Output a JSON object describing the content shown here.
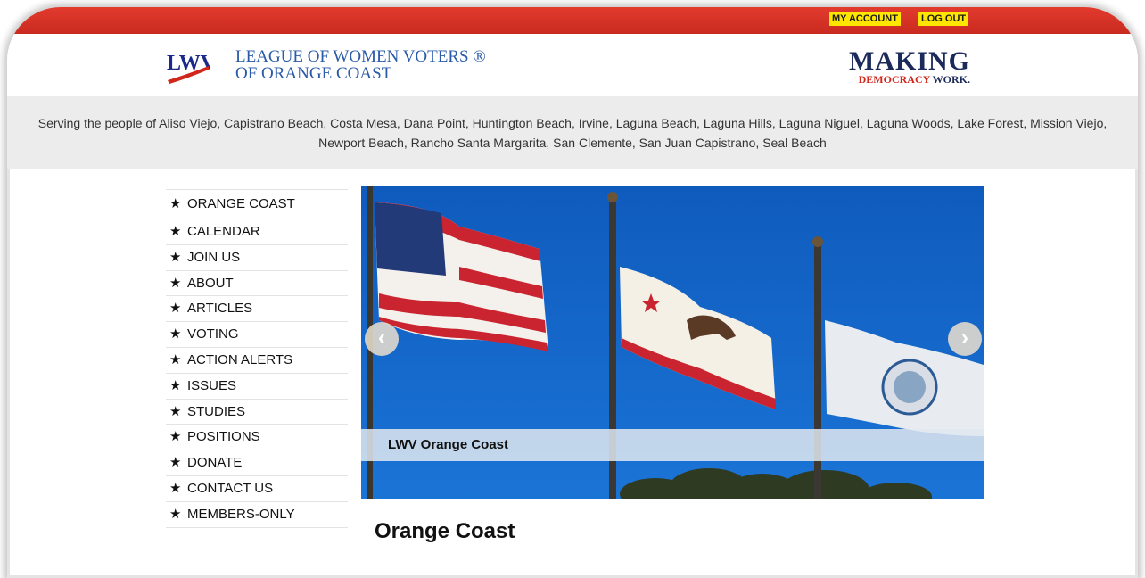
{
  "utility": {
    "my_account": "MY ACCOUNT",
    "log_out": "LOG OUT"
  },
  "header": {
    "logo_text": "LWV",
    "org_line1": "LEAGUE OF WOMEN VOTERS ®",
    "org_line2": "OF ORANGE COAST",
    "tagline_top": "MAKING",
    "tagline_demo": "DEMOCRACY",
    "tagline_work": "WORK."
  },
  "serving": {
    "text": "Serving the people of Aliso Viejo, Capistrano Beach, Costa Mesa, Dana Point, Huntington Beach, Irvine, Laguna Beach, Laguna Hills, Laguna Niguel, Laguna Woods, Lake Forest, Mission Viejo, Newport Beach, Rancho Santa Margarita, San Clemente, San Juan Capistrano, Seal Beach"
  },
  "nav": {
    "items": [
      {
        "label": "ORANGE COAST"
      },
      {
        "label": "CALENDAR"
      },
      {
        "label": "JOIN US"
      },
      {
        "label": "ABOUT"
      },
      {
        "label": "ARTICLES"
      },
      {
        "label": "VOTING"
      },
      {
        "label": "ACTION ALERTS"
      },
      {
        "label": "ISSUES"
      },
      {
        "label": "STUDIES"
      },
      {
        "label": "POSITIONS"
      },
      {
        "label": "DONATE"
      },
      {
        "label": "CONTACT US"
      },
      {
        "label": "MEMBERS-ONLY"
      }
    ]
  },
  "slider": {
    "caption": "LWV Orange Coast",
    "prev_icon": "chevron-left-icon",
    "next_icon": "chevron-right-icon"
  },
  "page": {
    "title": "Orange Coast"
  },
  "colors": {
    "topbar": "#d9332a",
    "utility_bg": "#ffe600",
    "org_blue": "#2a5aa8",
    "brand_navy": "#1b2a5a",
    "brand_red": "#d0261b",
    "sky": "#1565c4"
  }
}
